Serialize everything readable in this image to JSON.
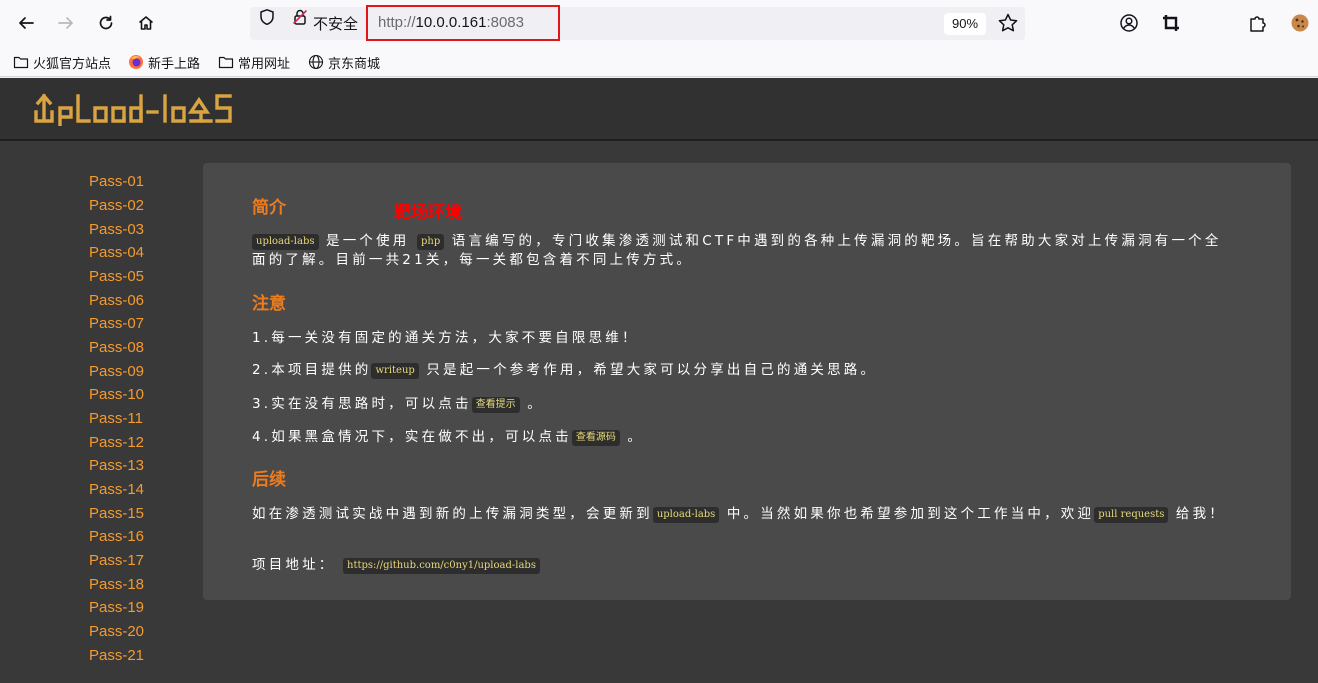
{
  "browser": {
    "insecure_label": "不安全",
    "url_scheme": "http://",
    "url_host": "10.0.0.161",
    "url_port": ":8083",
    "zoom": "90%",
    "bookmarks": [
      "火狐官方站点",
      "新手上路",
      "常用网址",
      "京东商城"
    ],
    "highlight_color": "#e0161a"
  },
  "site": {
    "logo_text": "UpLoad-labs",
    "brand_color": "#d9a441"
  },
  "sidebar": {
    "items": [
      "Pass-01",
      "Pass-02",
      "Pass-03",
      "Pass-04",
      "Pass-05",
      "Pass-06",
      "Pass-07",
      "Pass-08",
      "Pass-09",
      "Pass-10",
      "Pass-11",
      "Pass-12",
      "Pass-13",
      "Pass-14",
      "Pass-15",
      "Pass-16",
      "Pass-17",
      "Pass-18",
      "Pass-19",
      "Pass-20",
      "Pass-21"
    ],
    "link_color": "#f59a2f"
  },
  "content": {
    "intro_title": "简介",
    "annotation": "靶场环境",
    "intro_code1": "upload-labs",
    "intro_a": "是一个使用",
    "intro_code2": "php",
    "intro_b": "语言编写的，专门收集渗透测试和CTF中遇到的各种上传漏洞的靶场。旨在帮助大家对上传漏洞有一个全面的了解。目前一共21关，每一关都包含着不同上传方式。",
    "notice_title": "注意",
    "note1": "1.每一关没有固定的通关方法，大家不要自限思维！",
    "note2_a": "2.本项目提供的",
    "note2_code": "writeup",
    "note2_b": "只是起一个参考作用，希望大家可以分享出自己的通关思路。",
    "note3_a": "3.实在没有思路时，可以点击",
    "note3_link": "查看提示",
    "note3_b": "。",
    "note4_a": "4.如果黑盒情况下，实在做不出，可以点击",
    "note4_link": "查看源码",
    "note4_b": "。",
    "followup_title": "后续",
    "follow_a": "如在渗透测试实战中遇到新的上传漏洞类型，会更新到",
    "follow_code1": "upload-labs",
    "follow_b": "中。当然如果你也希望参加到这个工作当中，欢迎",
    "follow_code2": "pull requests",
    "follow_c": "给我！",
    "repo_label": "项目地址：",
    "repo_url": "https://github.com/c0ny1/upload-labs"
  }
}
